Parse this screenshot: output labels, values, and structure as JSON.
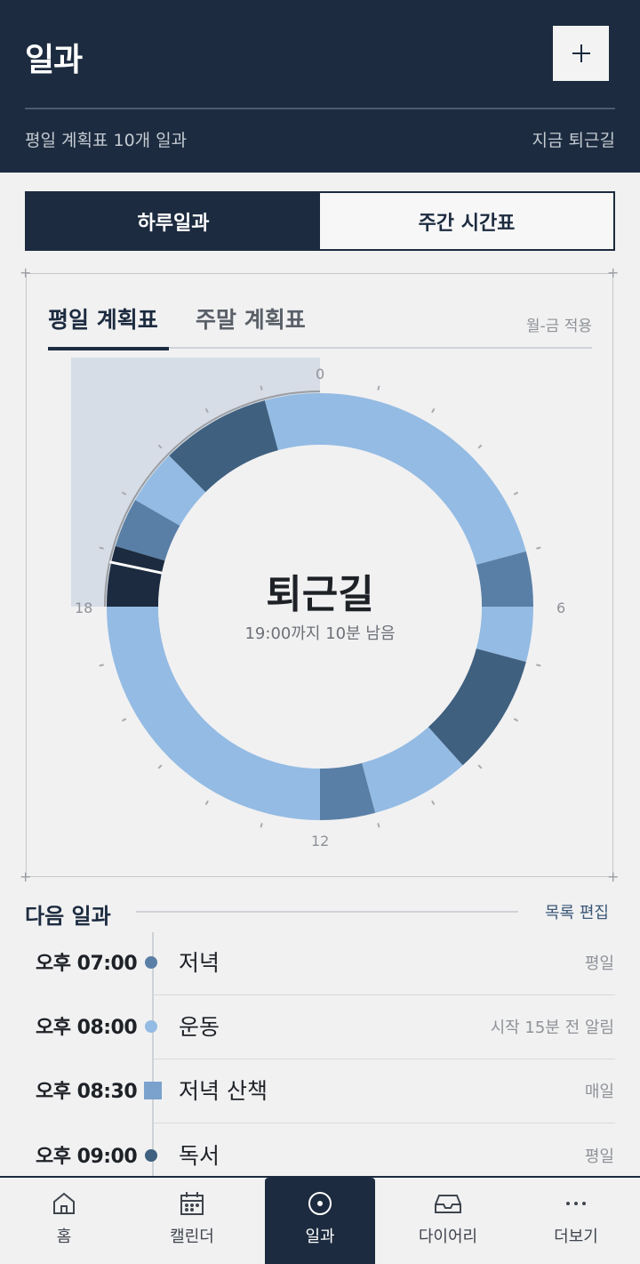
{
  "header": {
    "title": "일과",
    "subtitle_left": "평일 계획표 10개 일과",
    "subtitle_right": "지금 퇴근길"
  },
  "segments": [
    "하루일과",
    "주간 시간표"
  ],
  "tabs": {
    "active": "평일 계획표",
    "inactive": "주말 계획표",
    "note": "월-금 적용"
  },
  "clock": {
    "center_title": "퇴근길",
    "center_sub": "19:00까지 10분 남음",
    "hour_labels": {
      "top": "0",
      "right": "6",
      "bottom": "12",
      "left": "18"
    },
    "total_hours": 24,
    "segments": [
      {
        "start": 0,
        "end": 5.0,
        "color": "#94bbe3"
      },
      {
        "start": 5.0,
        "end": 6.0,
        "color": "#5a7fa6"
      },
      {
        "start": 6.0,
        "end": 7.0,
        "color": "#94bbe3"
      },
      {
        "start": 7.0,
        "end": 9.2,
        "color": "#3f607f"
      },
      {
        "start": 9.2,
        "end": 11.0,
        "color": "#94bbe3"
      },
      {
        "start": 11.0,
        "end": 12.0,
        "color": "#5a7fa6"
      },
      {
        "start": 12.0,
        "end": 18.0,
        "color": "#94bbe3"
      },
      {
        "start": 18.0,
        "end": 19.1,
        "color": "#1c2b3f"
      },
      {
        "start": 19.1,
        "end": 20.0,
        "color": "#5a7fa6"
      },
      {
        "start": 20.0,
        "end": 21.0,
        "color": "#94bbe3"
      },
      {
        "start": 21.0,
        "end": 23.0,
        "color": "#3f607f"
      },
      {
        "start": 23.0,
        "end": 24.0,
        "color": "#94bbe3"
      }
    ],
    "now_hour": 18.8,
    "elapsed_start_hour": 18.0,
    "colors": {
      "light": "#94bbe3",
      "mid": "#5a7fa6",
      "dark": "#3f607f",
      "navy": "#1c2b3f",
      "elapsed": "#d6dde6"
    }
  },
  "next": {
    "heading": "다음 일과",
    "edit": "목록 편집",
    "items": [
      {
        "time": "오후 07:00",
        "name": "저녁",
        "tag": "평일",
        "color": "#5a7fa6",
        "marker": "dot"
      },
      {
        "time": "오후 08:00",
        "name": "운동",
        "tag": "시작 15분 전 알림",
        "color": "#94bbe3",
        "marker": "dot"
      },
      {
        "time": "오후 08:30",
        "name": "저녁 산책",
        "tag": "매일",
        "color": "#7aa2cc",
        "marker": "square"
      },
      {
        "time": "오후 09:00",
        "name": "독서",
        "tag": "평일",
        "color": "#3f607f",
        "marker": "dot"
      }
    ]
  },
  "nav": [
    {
      "label": "홈",
      "icon": "home-icon"
    },
    {
      "label": "캘린더",
      "icon": "calendar-icon"
    },
    {
      "label": "일과",
      "icon": "clock-dot-icon",
      "active": true
    },
    {
      "label": "다이어리",
      "icon": "inbox-icon"
    },
    {
      "label": "더보기",
      "icon": "more-icon"
    }
  ]
}
